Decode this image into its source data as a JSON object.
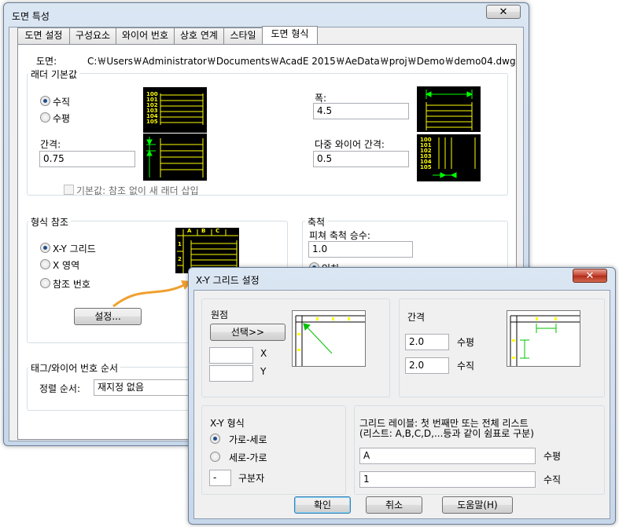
{
  "main_window": {
    "title": "도면 특성",
    "tabs": [
      "도면 설정",
      "구성요소",
      "와이어 번호",
      "상호 연계",
      "스타일",
      "도면 형식"
    ],
    "drawing_label": "도면:",
    "drawing_path": "C:￦Users￦Administrator￦Documents￦AcadE 2015￦AeData￦proj￦Demo￦demo04.dwg",
    "ladder_group": {
      "title": "래더 기본값",
      "vertical": "수직",
      "horizontal": "수평",
      "spacing_label": "간격:",
      "spacing_value": "0.75",
      "width_label": "폭:",
      "width_value": "4.5",
      "multi_wire_label": "다중 와이어 간격:",
      "multi_wire_value": "0.5",
      "default_checkbox": "기본값: 참조 없이 새 래더 삽입",
      "preview_numbers": [
        "100",
        "101",
        "102",
        "103",
        "104",
        "105"
      ]
    },
    "format_group": {
      "title": "형식 참조",
      "xy_grid": "X-Y 그리드",
      "x_zone": "X 영역",
      "ref_number": "참조 번호",
      "setup_button": "설정...",
      "grid_preview_cols": [
        "A",
        "B",
        "C"
      ],
      "grid_preview_rows": [
        "1",
        "2"
      ]
    },
    "scale_group": {
      "title": "축척",
      "feature_scale_label": "피쳐 축척 승수:",
      "feature_scale_value": "1.0",
      "inch": "인치"
    },
    "tag_group": {
      "title": "태그/와이어 번호 순서",
      "sort_label": "정렬 순서:",
      "sort_value": "재지정 없음"
    }
  },
  "dialog": {
    "title": "X-Y 그리드 설정",
    "origin": {
      "title": "원점",
      "select_button": "선택>>",
      "x_label": "X",
      "y_label": "Y",
      "x_value": "",
      "y_value": ""
    },
    "spacing": {
      "title": "간격",
      "horizontal_value": "2.0",
      "horizontal_label": "수평",
      "vertical_value": "2.0",
      "vertical_label": "수직"
    },
    "format": {
      "title": "X-Y 형식",
      "row_col": "가로-세로",
      "col_row": "세로-가로",
      "separator_value": "-",
      "separator_label": "구분자"
    },
    "labels": {
      "title_line1": "그리드 레이블: 첫 번째만 또는 전체 리스트",
      "title_line2": "(리스트: A,B,C,D,...등과 같이 쉼표로 구분)",
      "horizontal_value": "A",
      "horizontal_label": "수평",
      "vertical_value": "1",
      "vertical_label": "수직"
    },
    "buttons": {
      "ok": "확인",
      "cancel": "취소",
      "help": "도움말(H)"
    }
  },
  "colors": {
    "accent_arrow": "#f0a030",
    "preview_yellow": "#ffff00",
    "preview_green": "#00ff00",
    "close_red": "#c4402f"
  }
}
